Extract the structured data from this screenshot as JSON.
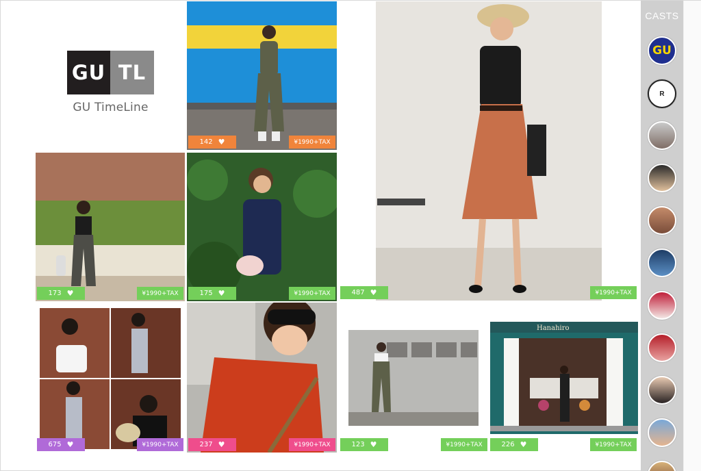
{
  "logo": {
    "left": "GU",
    "right": "TL",
    "subtitle": "GU TimeLine"
  },
  "sidebar": {
    "title": "CASTS",
    "casts": [
      {
        "name": "gu",
        "label": "GU"
      },
      {
        "name": "r",
        "label": "R"
      },
      {
        "name": "cast-3",
        "label": ""
      },
      {
        "name": "cast-4",
        "label": ""
      },
      {
        "name": "cast-5",
        "label": ""
      },
      {
        "name": "cast-6",
        "label": ""
      },
      {
        "name": "cast-7",
        "label": ""
      },
      {
        "name": "cast-8",
        "label": ""
      },
      {
        "name": "cast-9",
        "label": ""
      },
      {
        "name": "cast-10",
        "label": ""
      },
      {
        "name": "cast-11",
        "label": ""
      }
    ]
  },
  "posts": [
    {
      "likes": "142",
      "price": "¥1990+TAX",
      "color": "#f0843b",
      "photo": "woman-jumpsuit-blue-wall"
    },
    {
      "likes": "173",
      "price": "¥1990+TAX",
      "color": "#74cf5a",
      "photo": "woman-overalls-hedge"
    },
    {
      "likes": "175",
      "price": "¥1990+TAX",
      "color": "#74cf5a",
      "photo": "woman-navy-top-leaves"
    },
    {
      "likes": "487",
      "price": "¥1990+TAX",
      "color": "#74cf5a",
      "photo": "woman-orange-skirt"
    },
    {
      "likes": "675",
      "price": "¥1990+TAX",
      "color": "#b06ad8",
      "photo": "collage-two-women"
    },
    {
      "likes": "237",
      "price": "¥1990+TAX",
      "color": "#ef4d8c",
      "photo": "woman-orange-top-selfie"
    },
    {
      "likes": "123",
      "price": "¥1990+TAX",
      "color": "#74cf5a",
      "photo": "woman-jumpsuit-wall"
    },
    {
      "likes": "226",
      "price": "¥1990+TAX",
      "color": "#74cf5a",
      "photo": "flower-shop-storefront"
    }
  ],
  "shop_sign": "Hanahiro",
  "icons": {
    "heart": "heart-icon"
  }
}
